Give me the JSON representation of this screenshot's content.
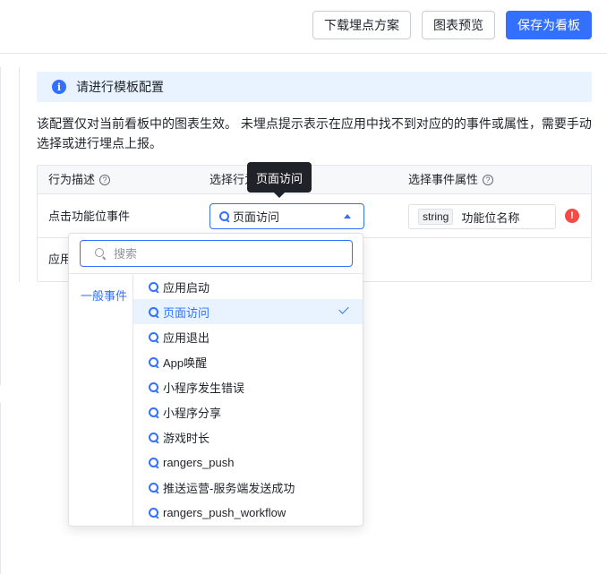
{
  "toolbar": {
    "download_label": "下载埋点方案",
    "preview_label": "图表预览",
    "save_label": "保存为看板"
  },
  "banner": {
    "icon": "info-icon",
    "text": "请进行模板配置"
  },
  "description": "该配置仅对当前看板中的图表生效。 未埋点提示表示在应用中找不到对应的的事件或属性，需要手动选择或进行埋点上报。",
  "table": {
    "headers": [
      "行为描述",
      "选择行为",
      "选择事件属性"
    ],
    "rows": [
      {
        "behavior": "点击功能位事件",
        "event": "页面访问",
        "property_type": "string",
        "property_name": "功能位名称",
        "status_icon": "error-icon"
      },
      {
        "behavior": "应用"
      }
    ]
  },
  "tooltip": {
    "text": "页面访问"
  },
  "dropdown": {
    "search_placeholder": "搜索",
    "category": "一般事件",
    "items": [
      {
        "label": "应用启动",
        "selected": false
      },
      {
        "label": "页面访问",
        "selected": true
      },
      {
        "label": "应用退出",
        "selected": false
      },
      {
        "label": "App唤醒",
        "selected": false
      },
      {
        "label": "小程序发生错误",
        "selected": false
      },
      {
        "label": "小程序分享",
        "selected": false
      },
      {
        "label": "游戏时长",
        "selected": false
      },
      {
        "label": "rangers_push",
        "selected": false
      },
      {
        "label": "推送运营-服务端发送成功",
        "selected": false
      },
      {
        "label": "rangers_push_workflow",
        "selected": false
      }
    ]
  },
  "colors": {
    "primary": "#3370ff",
    "error": "#f54a45",
    "banner_bg": "#e8f3ff"
  }
}
